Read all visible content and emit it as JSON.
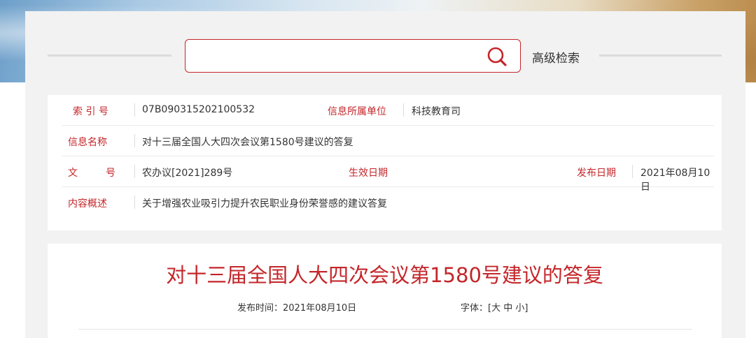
{
  "search": {
    "placeholder": "",
    "advanced_label": "高级检索"
  },
  "meta": {
    "index_label": "索 引 号",
    "index_value": "07B090315202100532",
    "unit_label": "信息所属单位",
    "unit_value": "科技教育司",
    "name_label": "信息名称",
    "name_value": "对十三届全国人大四次会议第1580号建议的答复",
    "docno_label": "文　　号",
    "docno_value": "农办议[2021]289号",
    "effective_label": "生效日期",
    "effective_value": "",
    "publish_label": "发布日期",
    "publish_value": "2021年08月10日",
    "summary_label": "内容概述",
    "summary_value": "关于增强农业吸引力提升农民职业身份荣誉感的建议答复"
  },
  "article": {
    "title": "对十三届全国人大四次会议第1580号建议的答复",
    "publish_time": "发布时间：2021年08月10日",
    "font_label": "字体：[",
    "font_large": "大",
    "font_medium": "中",
    "font_small": "小",
    "font_close": "]"
  },
  "colors": {
    "accent": "#c4262a",
    "panel_bg": "#f2f2f2"
  },
  "icons": {
    "search": "search-icon"
  }
}
